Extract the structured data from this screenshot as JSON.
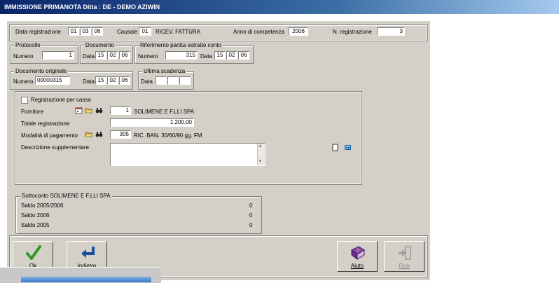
{
  "window": {
    "title": "IMMISSIONE PRIMANOTA  Ditta : DE  - DEMO AZIWIN"
  },
  "header": {
    "data_registrazione_label": "Data registrazione",
    "data_registrazione": [
      "01",
      "03",
      "06"
    ],
    "causale_label": "Causale",
    "causale_code": "01",
    "causale_desc": "RICEV. FATTURA",
    "anno_label": "Anno di competenza",
    "anno": "2006",
    "nreg_label": "N. registrazione",
    "nreg": "3"
  },
  "protocollo": {
    "title": "Protocollo",
    "numero_label": "Numero",
    "numero": "1"
  },
  "documento": {
    "title": "Documento",
    "data_label": "Data",
    "data": [
      "15",
      "02",
      "06"
    ]
  },
  "riferimento": {
    "title": "Riferimento partita estratto conto",
    "numero_label": "Numero",
    "numero": "315",
    "data_label": "Data",
    "data": [
      "15",
      "02",
      "06"
    ]
  },
  "documento_originale": {
    "title": "Documento originale",
    "numero_label": "Numero",
    "numero": "00000315",
    "data_label": "Data",
    "data": [
      "15",
      "02",
      "06"
    ]
  },
  "ultima_scadenza": {
    "title": "Ultima scadenza",
    "data_label": "Data",
    "data": [
      "",
      "",
      ""
    ]
  },
  "details": {
    "registrazione_per_cassa_label": "Registrazione per cassa",
    "registrazione_per_cassa_checked": false,
    "fornitore_label": "Fornitore",
    "fornitore_code": "1",
    "fornitore_name": "SOLIMENE E F.LLI SPA",
    "totale_label": "Totale registrazione",
    "totale": "1.200,00",
    "modalita_label": "Modalità di pagamento",
    "modalita_code": "305",
    "modalita_desc": "RIC. BAN. 30/60/90 gg. FM",
    "descrizione_label": "Descrizione supplementare",
    "descrizione": ""
  },
  "sottoconto": {
    "title": "Sottoconto  SOLIMENE E F.LLI SPA",
    "rows": [
      {
        "label": "Saldo 2005/2006",
        "value": "0"
      },
      {
        "label": "Saldo 2006",
        "value": "0"
      },
      {
        "label": "Saldo 2005",
        "value": "0"
      }
    ]
  },
  "buttons": {
    "ok": "Ok",
    "indietro": "Indietro",
    "aiuto": "Aiuto",
    "fine": "Fine"
  },
  "colors": {
    "title_bar": "#0a246a",
    "dialog_bg": "#d4d0c8",
    "accent_green": "#2e9a1e",
    "accent_blue": "#1a4fa0"
  }
}
